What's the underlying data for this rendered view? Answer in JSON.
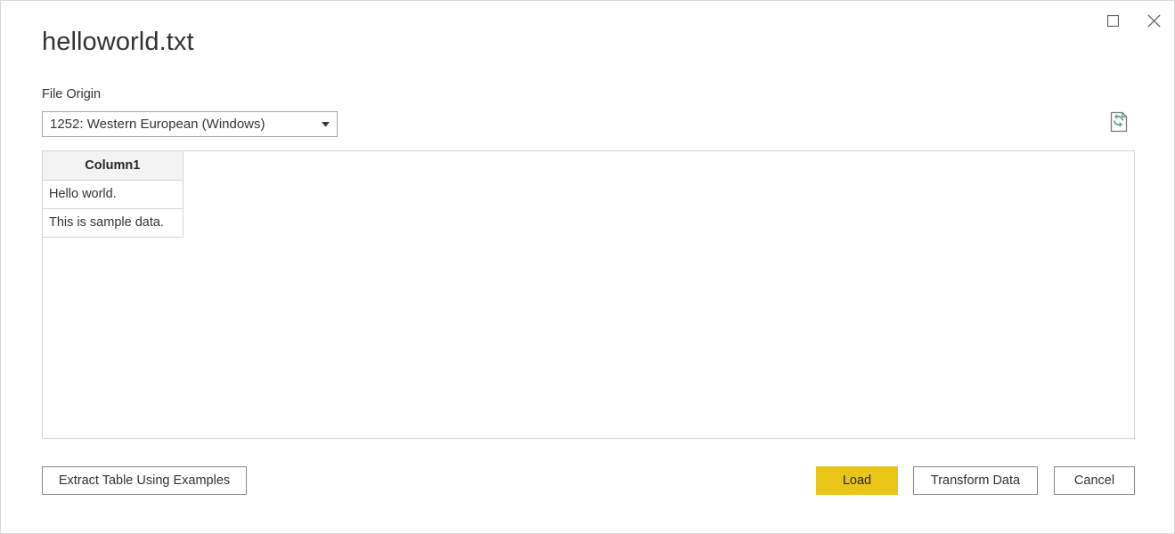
{
  "window": {
    "title": "helloworld.txt",
    "controls": {
      "maximize_name": "maximize-button",
      "close_name": "close-button"
    }
  },
  "file_origin": {
    "label": "File Origin",
    "value": "1252: Western European (Windows)",
    "options": [
      "1252: Western European (Windows)"
    ]
  },
  "refresh": {
    "tooltip": "Refresh preview"
  },
  "preview": {
    "columns": [
      "Column1"
    ],
    "rows": [
      [
        "Hello world."
      ],
      [
        "This is sample data."
      ]
    ]
  },
  "footer": {
    "extract_label": "Extract Table Using Examples",
    "load_label": "Load",
    "transform_label": "Transform Data",
    "cancel_label": "Cancel"
  },
  "colors": {
    "accent": "#e8c517",
    "border": "#8a8886",
    "panel_border": "#d4d4d4",
    "header_bg": "#f3f3f3",
    "text": "#333333",
    "refresh_green": "#6fa98c"
  }
}
